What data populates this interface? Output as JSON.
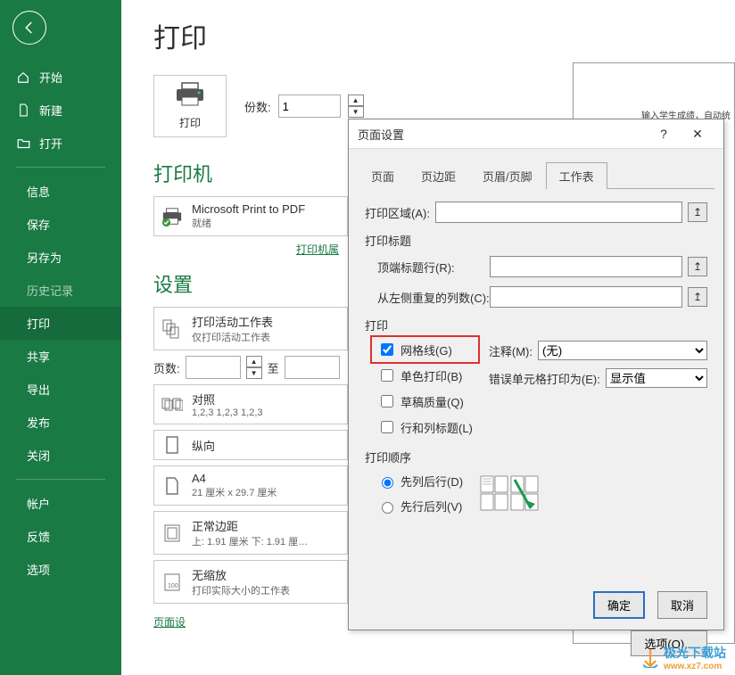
{
  "sidebar": {
    "items": [
      {
        "label": "开始"
      },
      {
        "label": "新建"
      },
      {
        "label": "打开"
      },
      {
        "label": "信息"
      },
      {
        "label": "保存"
      },
      {
        "label": "另存为"
      },
      {
        "label": "历史记录"
      },
      {
        "label": "打印"
      },
      {
        "label": "共享"
      },
      {
        "label": "导出"
      },
      {
        "label": "发布"
      },
      {
        "label": "关闭"
      },
      {
        "label": "帐户"
      },
      {
        "label": "反馈"
      },
      {
        "label": "选项"
      }
    ]
  },
  "main": {
    "title": "打印",
    "print_btn_label": "打印",
    "copies_label": "份数:",
    "copies_value": "1",
    "printer_heading": "打印机",
    "printer_name": "Microsoft Print to PDF",
    "printer_status": "就绪",
    "printer_props_link": "打印机属",
    "settings_heading": "设置",
    "dd_scope_title": "打印活动工作表",
    "dd_scope_sub": "仅打印活动工作表",
    "pages_label": "页数:",
    "pages_to": "至",
    "dd_collate_title": "对照",
    "dd_collate_sub": "1,2,3    1,2,3    1,2,3",
    "dd_orient_title": "纵向",
    "dd_paper_title": "A4",
    "dd_paper_sub": "21 厘米 x 29.7 厘米",
    "dd_margin_title": "正常边距",
    "dd_margin_sub": "上: 1.91 厘米 下: 1.91 厘…",
    "dd_scale_title": "无缩放",
    "dd_scale_sub": "打印实际大小的工作表",
    "page_setup_link": "页面设",
    "preview_text": "输入学生成绩，自动统"
  },
  "dlg": {
    "title": "页面设置",
    "tabs": [
      "页面",
      "页边距",
      "页眉/页脚",
      "工作表"
    ],
    "print_area": "打印区域(A):",
    "titles_heading": "打印标题",
    "top_row": "顶端标题行(R):",
    "left_col": "从左侧重复的列数(C):",
    "print_heading": "打印",
    "cb_grid": "网格线(G)",
    "cb_bw": "单色打印(B)",
    "cb_draft": "草稿质量(Q)",
    "cb_rowcol": "行和列标题(L)",
    "comments_label": "注释(M):",
    "comments_val": "(无)",
    "errors_label": "错误单元格打印为(E):",
    "errors_val": "显示值",
    "order_heading": "打印顺序",
    "order_downover": "先列后行(D)",
    "order_overdown": "先行后列(V)",
    "options_btn": "选项(O)...",
    "ok": "确定",
    "cancel": "取消"
  },
  "watermark": {
    "name": "极光下载站",
    "url": "www.xz7.com"
  }
}
